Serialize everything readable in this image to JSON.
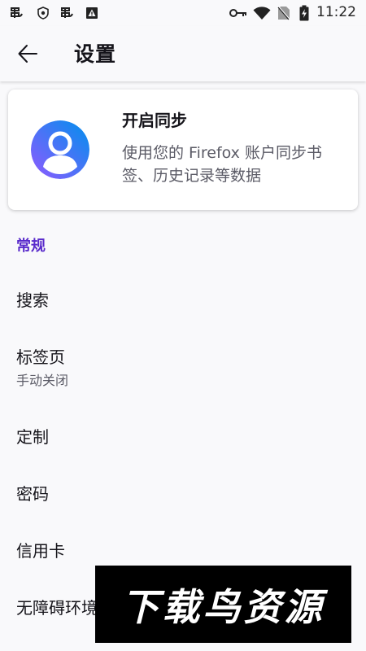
{
  "status_bar": {
    "time": "11:22",
    "icons": [
      "app-notification-icon",
      "shield-icon",
      "app-notification-icon",
      "warning-icon",
      "key-icon",
      "wifi-icon",
      "no-sim-icon",
      "battery-charging-icon"
    ]
  },
  "app_bar": {
    "title": "设置",
    "back_icon": "arrow-left-icon"
  },
  "sync_card": {
    "title": "开启同步",
    "description": "使用您的 Firefox 账户同步书签、历史记录等数据",
    "avatar_gradient": [
      "#9059ff",
      "#0090ed"
    ]
  },
  "section": {
    "header": "常规",
    "accent_color": "#592acb"
  },
  "items": [
    {
      "title": "搜索",
      "summary": ""
    },
    {
      "title": "标签页",
      "summary": "手动关闭"
    },
    {
      "title": "定制",
      "summary": ""
    },
    {
      "title": "密码",
      "summary": ""
    },
    {
      "title": "信用卡",
      "summary": ""
    },
    {
      "title": "无障碍环境",
      "summary": ""
    }
  ],
  "watermark": {
    "text": "下载鸟资源"
  }
}
